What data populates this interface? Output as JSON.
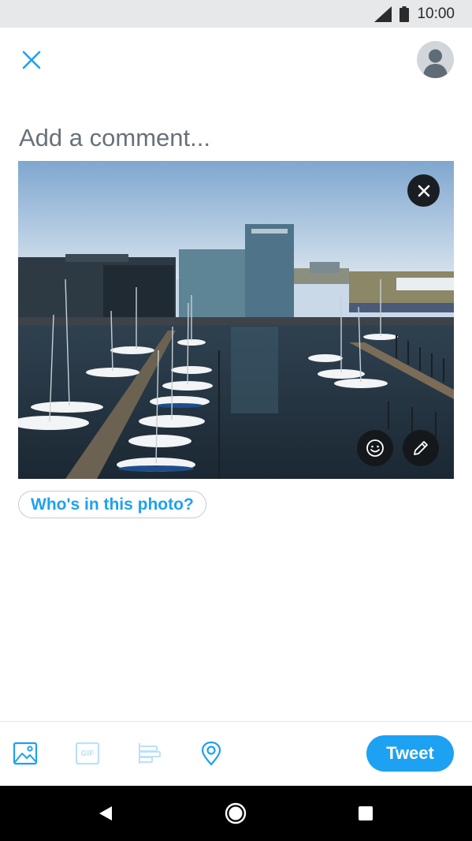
{
  "status_bar": {
    "time": "10:00",
    "icons": [
      "signal-icon",
      "battery-icon"
    ]
  },
  "header": {
    "close_icon": "close-icon",
    "avatar_icon": "avatar"
  },
  "compose": {
    "placeholder": "Add a comment...",
    "value": ""
  },
  "photo": {
    "description_icon": "harbor-photo",
    "remove_icon": "close-icon",
    "sticker_icon": "smiley-icon",
    "edit_icon": "pencil-icon"
  },
  "tag_people": {
    "label": "Who's in this photo?"
  },
  "toolbar": {
    "image_icon": "image-icon",
    "gif_label": "GIF",
    "poll_icon": "poll-icon",
    "location_icon": "location-pin-icon",
    "tweet_label": "Tweet"
  },
  "colors": {
    "accent": "#1da1f2",
    "statusbar": "#e6e8ea",
    "navbar": "#000000"
  },
  "nav_bar": {
    "icons": [
      "back-icon",
      "home-icon",
      "recents-icon"
    ]
  }
}
